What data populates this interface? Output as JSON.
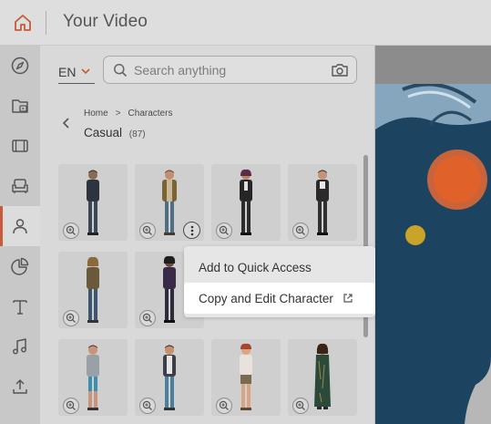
{
  "header": {
    "title": "Your Video",
    "home_icon": "home-icon",
    "accent": "#c65a3a"
  },
  "sidebar": {
    "items": [
      {
        "name": "explore",
        "icon": "compass-icon"
      },
      {
        "name": "media",
        "icon": "media-folder-icon"
      },
      {
        "name": "film",
        "icon": "film-icon"
      },
      {
        "name": "props",
        "icon": "armchair-icon"
      },
      {
        "name": "characters",
        "icon": "person-icon",
        "active": true
      },
      {
        "name": "charts",
        "icon": "pie-chart-icon"
      },
      {
        "name": "text",
        "icon": "text-icon"
      },
      {
        "name": "audio",
        "icon": "music-note-icon"
      },
      {
        "name": "upload",
        "icon": "upload-icon"
      }
    ]
  },
  "panel": {
    "language": "EN",
    "search": {
      "placeholder": "Search anything",
      "value": ""
    },
    "breadcrumb": {
      "home": "Home",
      "separator": ">",
      "current": "Characters"
    },
    "section": {
      "title": "Casual",
      "count": "(87)"
    }
  },
  "context_menu": {
    "items": [
      {
        "label": "Add to Quick Access"
      },
      {
        "label": "Copy and Edit Character",
        "icon": "external-link-icon",
        "highlighted": true
      }
    ]
  }
}
